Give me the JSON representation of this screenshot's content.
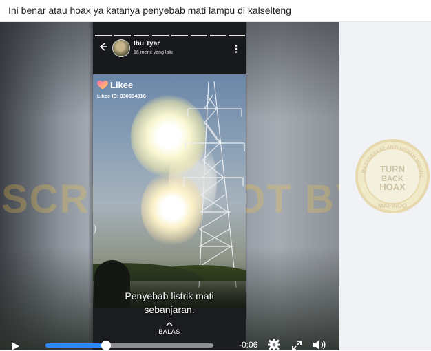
{
  "post": {
    "caption": "Ini benar atau hoax ya katanya penyebab mati lampu di kalselteng"
  },
  "story": {
    "user_name": "Ibu Tyar",
    "posted_time": "16 menit yang lalu",
    "progress_segments": 8,
    "icons": {
      "back": "arrow-left-icon",
      "more": "more-vertical-icon",
      "avatar": "user-avatar"
    }
  },
  "video_overlay": {
    "brand": "Likee",
    "brand_id": "Likee ID: 330994816",
    "subtitle_lines": [
      "Penyebab listrik mati",
      "sebanjaran."
    ],
    "reply_label": "BALAS"
  },
  "watermark": {
    "text": "SCREENSHOT BY",
    "seal_lines": [
      "MASYARAKAT ANTI FITNAH INDONESIA",
      "TURN",
      "BACK",
      "HOAX",
      "MAFINDO"
    ]
  },
  "player": {
    "time_remaining": "-0:06",
    "progress_fraction": 0.36,
    "accent_color": "#2d88ff",
    "icons": [
      "play-icon",
      "gear-icon",
      "expand-icon",
      "volume-icon"
    ]
  }
}
